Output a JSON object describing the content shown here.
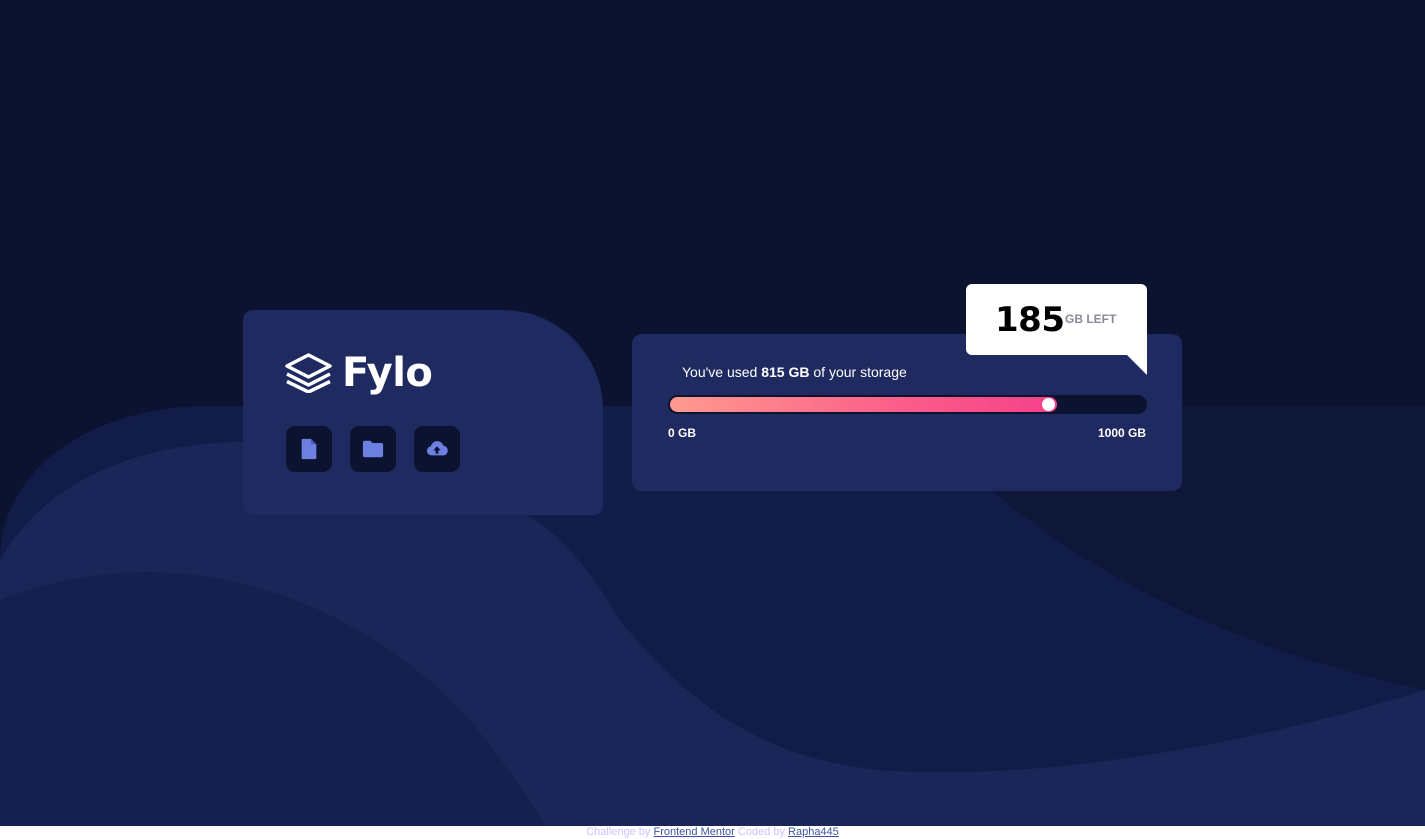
{
  "brand": {
    "name": "Fylo"
  },
  "icons": [
    {
      "name": "document-icon",
      "color": "#6d7fe0"
    },
    {
      "name": "folder-icon",
      "color": "#6d7fe0"
    },
    {
      "name": "upload-icon",
      "color": "#6d7fe0"
    }
  ],
  "storage": {
    "prefix": "You've used ",
    "used": "815 GB",
    "suffix": " of your storage",
    "min_label": "0 GB",
    "max_label": "1000 GB",
    "used_fraction": 0.815,
    "remaining_value": "185",
    "remaining_label": "GB LEFT"
  },
  "footer": {
    "challenge_prefix": "Challenge by ",
    "challenge_link": "Frontend Mentor",
    "coded_prefix": " Coded by ",
    "coded_link": "Rapha445"
  },
  "colors": {
    "background": "#0c1330",
    "card": "#1f2a60",
    "icon_tile": "#0c1330",
    "accent_gradient_start": "#ff9a8f",
    "accent_gradient_end": "#f5408a"
  }
}
